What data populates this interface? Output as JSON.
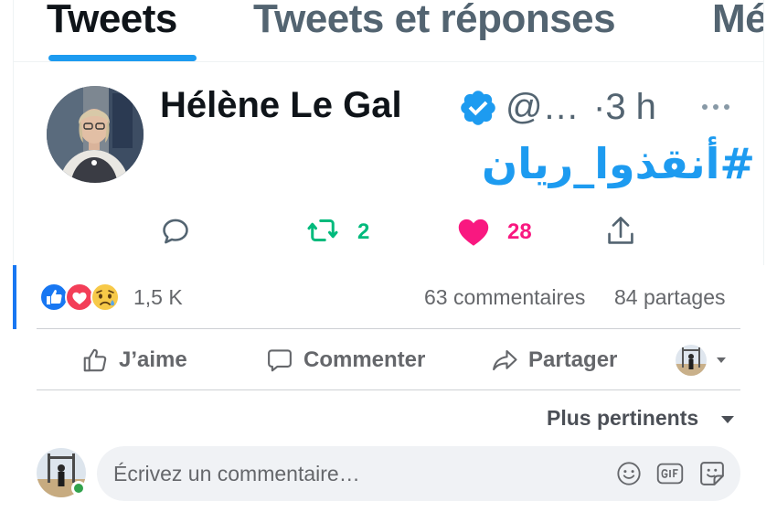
{
  "twitter": {
    "tabs": [
      {
        "label": "Tweets",
        "active": true
      },
      {
        "label": "Tweets et réponses",
        "active": false
      },
      {
        "label": "Mé",
        "active": false
      }
    ],
    "tweet": {
      "author_name": "Hélène Le Gal",
      "verified": true,
      "handle": "@…",
      "time": "·3 h",
      "hashtag": "#أنقذوا_ريان",
      "retweet_count": "2",
      "like_count": "28",
      "liked": true,
      "icons": [
        "reply-icon",
        "retweet-icon",
        "heart-icon",
        "share-icon",
        "more-icon",
        "verified-badge-icon"
      ]
    },
    "colors": {
      "accent": "#1d9bf0",
      "retweet": "#00ba7c",
      "like": "#f91880",
      "muted": "#536471"
    }
  },
  "facebook": {
    "reactions": [
      "like",
      "love",
      "sad"
    ],
    "reaction_count": "1,5 K",
    "comments_count": "63 commentaires",
    "shares_count": "84 partages",
    "actions": {
      "like_label": "J’aime",
      "comment_label": "Commenter",
      "share_label": "Partager"
    },
    "sort_label": "Plus pertinents",
    "comment_placeholder": "Écrivez un commentaire…",
    "comment_icons": [
      "emoji-icon",
      "gif-icon",
      "sticker-icon"
    ],
    "colors": {
      "blue": "#1877f2",
      "muted": "#65676b",
      "input_bg": "#f0f2f5",
      "online": "#31a24c"
    }
  }
}
